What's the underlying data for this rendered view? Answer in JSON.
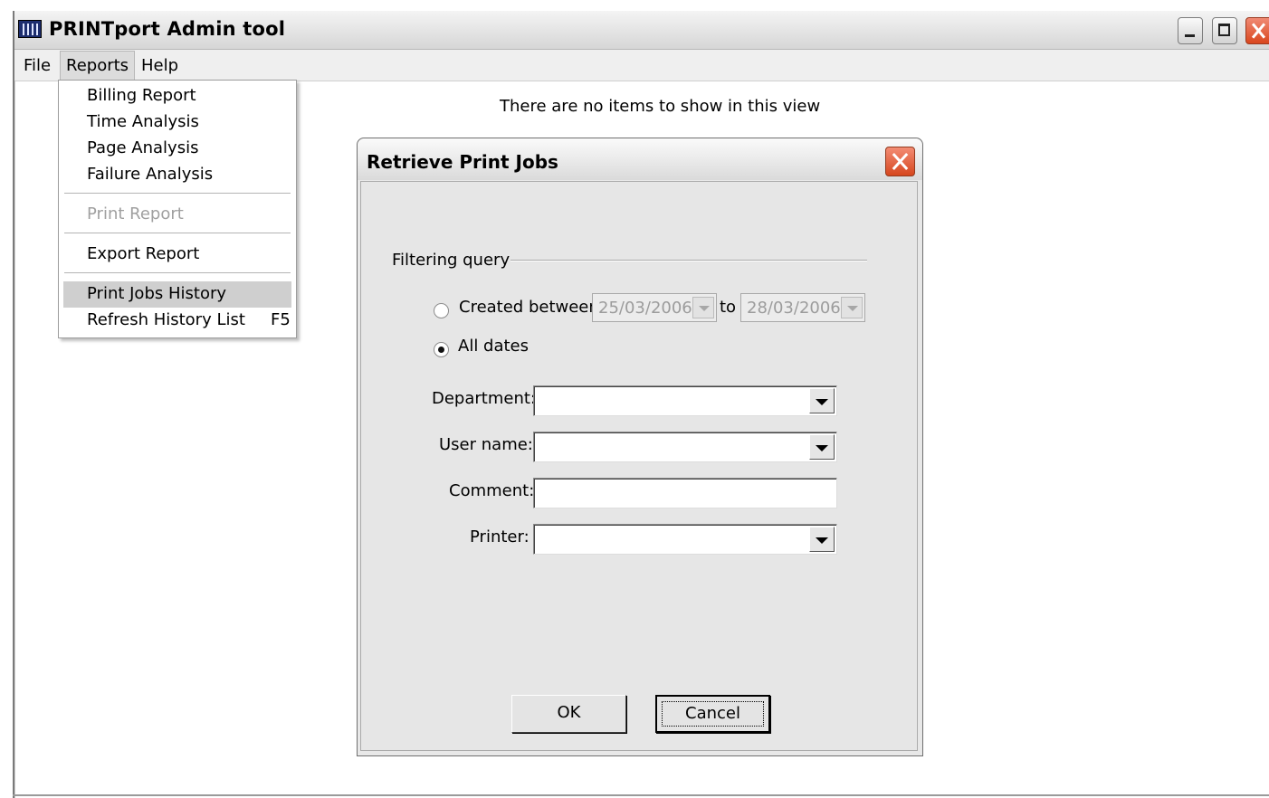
{
  "window": {
    "title": "PRINTport Admin tool",
    "icon": "printport-app-icon"
  },
  "menubar": {
    "file": "File",
    "reports": "Reports",
    "help": "Help"
  },
  "main": {
    "empty_message": "There are no items to show in this view"
  },
  "reports_menu": {
    "billing_report": "Billing Report",
    "time_analysis": "Time Analysis",
    "page_analysis": "Page Analysis",
    "failure_analysis": "Failure Analysis",
    "print_report": "Print Report",
    "export_report": "Export Report",
    "print_jobs_history": "Print Jobs History",
    "refresh_history_list": "Refresh History List",
    "refresh_shortcut": "F5",
    "highlighted": "Print Jobs History"
  },
  "dialog": {
    "title": "Retrieve Print Jobs",
    "group_label": "Filtering query",
    "created_between_label": "Created between:",
    "date_from": "25/03/2006",
    "to_label": "to",
    "date_to": "28/03/2006",
    "all_dates_label": "All dates",
    "selected_range_option": "All dates",
    "department_label": "Department:",
    "department_value": "",
    "user_name_label": "User name:",
    "user_name_value": "",
    "comment_label": "Comment:",
    "comment_value": "",
    "printer_label": "Printer:",
    "printer_value": "",
    "ok_label": "OK",
    "cancel_label": "Cancel"
  }
}
